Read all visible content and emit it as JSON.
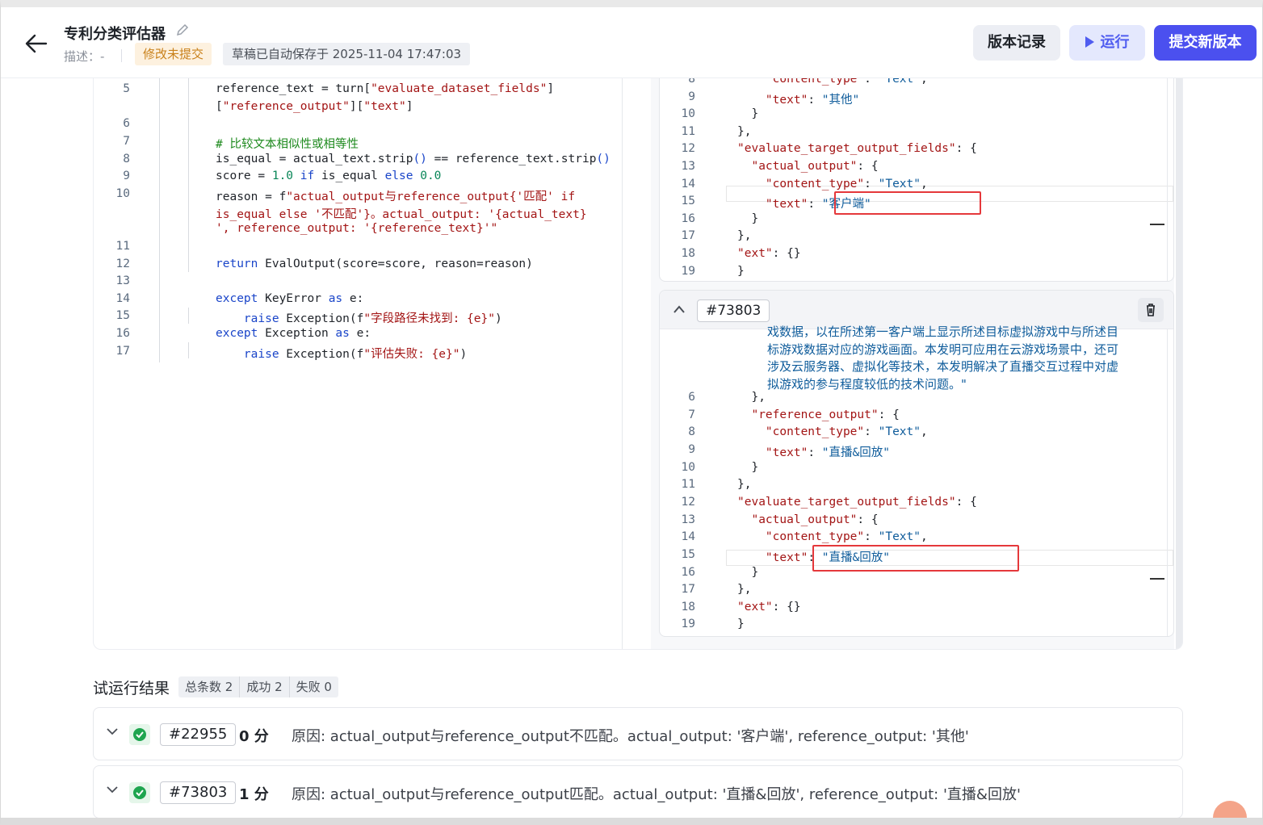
{
  "header": {
    "title": "专利分类评估器",
    "desc_label": "描述：-",
    "unsubmitted_badge": "修改未提交",
    "autosave_text": "草稿已自动保存于 2025-11-04 17:47:03",
    "history_button": "版本记录",
    "run_button": "运行",
    "submit_button": "提交新版本"
  },
  "code": {
    "lines": [
      {
        "n": "5",
        "html": "reference_text = turn[<span class='str'>\"evaluate_dataset_fields\"</span>]"
      },
      {
        "n": "",
        "html": "[<span class='str'>\"reference_output\"</span>][<span class='str'>\"text\"</span>]"
      },
      {
        "n": "6",
        "html": ""
      },
      {
        "n": "7",
        "html": "<span class='cmt'># 比较文本相似性或相等性</span>"
      },
      {
        "n": "8",
        "html": "is_equal = actual_text.strip<span class='kw'>()</span> == reference_text.strip<span class='kw'>()</span>"
      },
      {
        "n": "9",
        "html": "score = <span class='num'>1.0</span> <span class='kw'>if</span> is_equal <span class='kw'>else</span> <span class='num'>0.0</span>"
      },
      {
        "n": "10",
        "html": "reason = f<span class='str'>\"actual_output与reference_output{'匹配' if</span>"
      },
      {
        "n": "",
        "html": "<span class='str'>is_equal else '不匹配'}。actual_output: '{actual_text}</span>"
      },
      {
        "n": "",
        "html": "<span class='str'>', reference_output: '{reference_text}'\"</span>"
      },
      {
        "n": "11",
        "html": ""
      },
      {
        "n": "12",
        "html": "<span class='kw'>return</span> EvalOutput(score=score, reason=reason)"
      },
      {
        "n": "13",
        "html": ""
      },
      {
        "n": "14",
        "html": "<span class='kw'>except</span> KeyError <span class='kw'>as</span> e:"
      },
      {
        "n": "15",
        "html": "    <span class='kw'>raise</span> Exception(f<span class='str'>\"字段路径未找到: {e}\"</span>)"
      },
      {
        "n": "16",
        "html": "<span class='kw'>except</span> Exception <span class='kw'>as</span> e:"
      },
      {
        "n": "17",
        "html": "    <span class='kw'>raise</span> Exception(f<span class='str'>\"评估失败: {e}\"</span>)"
      }
    ]
  },
  "card1": {
    "lines": [
      {
        "n": "8",
        "html": "    <span class='jkey'>\"content_type\"</span>: <span class='jstr'>\"Text\"</span>,"
      },
      {
        "n": "9",
        "html": "    <span class='jkey'>\"text\"</span>: <span class='jstr'>\"其他\"</span>"
      },
      {
        "n": "10",
        "html": "  }"
      },
      {
        "n": "11",
        "html": "},"
      },
      {
        "n": "12",
        "html": "<span class='jkey'>\"evaluate_target_output_fields\"</span>: {"
      },
      {
        "n": "13",
        "html": "  <span class='jkey'>\"actual_output\"</span>: {"
      },
      {
        "n": "14",
        "html": "    <span class='jkey'>\"content_type\"</span>: <span class='jstr'>\"Text\"</span>,"
      },
      {
        "n": "15",
        "html": "    <span class='jkey'>\"text\"</span>: <span class='jstr'>\"客户端\"</span>"
      },
      {
        "n": "16",
        "html": "  }"
      },
      {
        "n": "17",
        "html": "},"
      },
      {
        "n": "18",
        "html": "<span class='jkey'>\"ext\"</span>: {}"
      },
      {
        "n": "19",
        "html": "}"
      }
    ]
  },
  "card2": {
    "id": "#73803",
    "wrap_text": [
      "戏数据，以在所述第一客户端上显示所述目标虚拟游戏中与所述目",
      "标游戏数据对应的游戏画面。本发明可应用在云游戏场景中，还可",
      "涉及云服务器、虚拟化等技术，本发明解决了直播交互过程中对虚",
      "拟游戏的参与程度较低的技术问题。\""
    ],
    "lines": [
      {
        "n": "6",
        "html": "  },"
      },
      {
        "n": "7",
        "html": "  <span class='jkey'>\"reference_output\"</span>: {"
      },
      {
        "n": "8",
        "html": "    <span class='jkey'>\"content_type\"</span>: <span class='jstr'>\"Text\"</span>,"
      },
      {
        "n": "9",
        "html": "    <span class='jkey'>\"text\"</span>: <span class='jstr'>\"直播&amp;回放\"</span>"
      },
      {
        "n": "10",
        "html": "  }"
      },
      {
        "n": "11",
        "html": "},"
      },
      {
        "n": "12",
        "html": "<span class='jkey'>\"evaluate_target_output_fields\"</span>: {"
      },
      {
        "n": "13",
        "html": "  <span class='jkey'>\"actual_output\"</span>: {"
      },
      {
        "n": "14",
        "html": "    <span class='jkey'>\"content_type\"</span>: <span class='jstr'>\"Text\"</span>,"
      },
      {
        "n": "15",
        "html": "    <span class='jkey'>\"text\"</span>: <span class='jstr'>\"直播&amp;回放\"</span>"
      },
      {
        "n": "16",
        "html": "  }"
      },
      {
        "n": "17",
        "html": "},"
      },
      {
        "n": "18",
        "html": "<span class='jkey'>\"ext\"</span>: {}"
      },
      {
        "n": "19",
        "html": "}"
      }
    ]
  },
  "results": {
    "title": "试运行结果",
    "total": "总条数 2",
    "success": "成功 2",
    "fail": "失败 0",
    "rows": [
      {
        "id": "#22955",
        "score": "0 分",
        "reason": "原因: actual_output与reference_output不匹配。actual_output: '客户端', reference_output: '其他'"
      },
      {
        "id": "#73803",
        "score": "1 分",
        "reason": "原因: actual_output与reference_output匹配。actual_output: '直播&回放', reference_output: '直播&回放'"
      }
    ]
  },
  "colors": {
    "accent": "#4b50ef",
    "warning_bg": "#fdf1df",
    "success": "#1ea54f",
    "highlight": "#e5383b"
  }
}
